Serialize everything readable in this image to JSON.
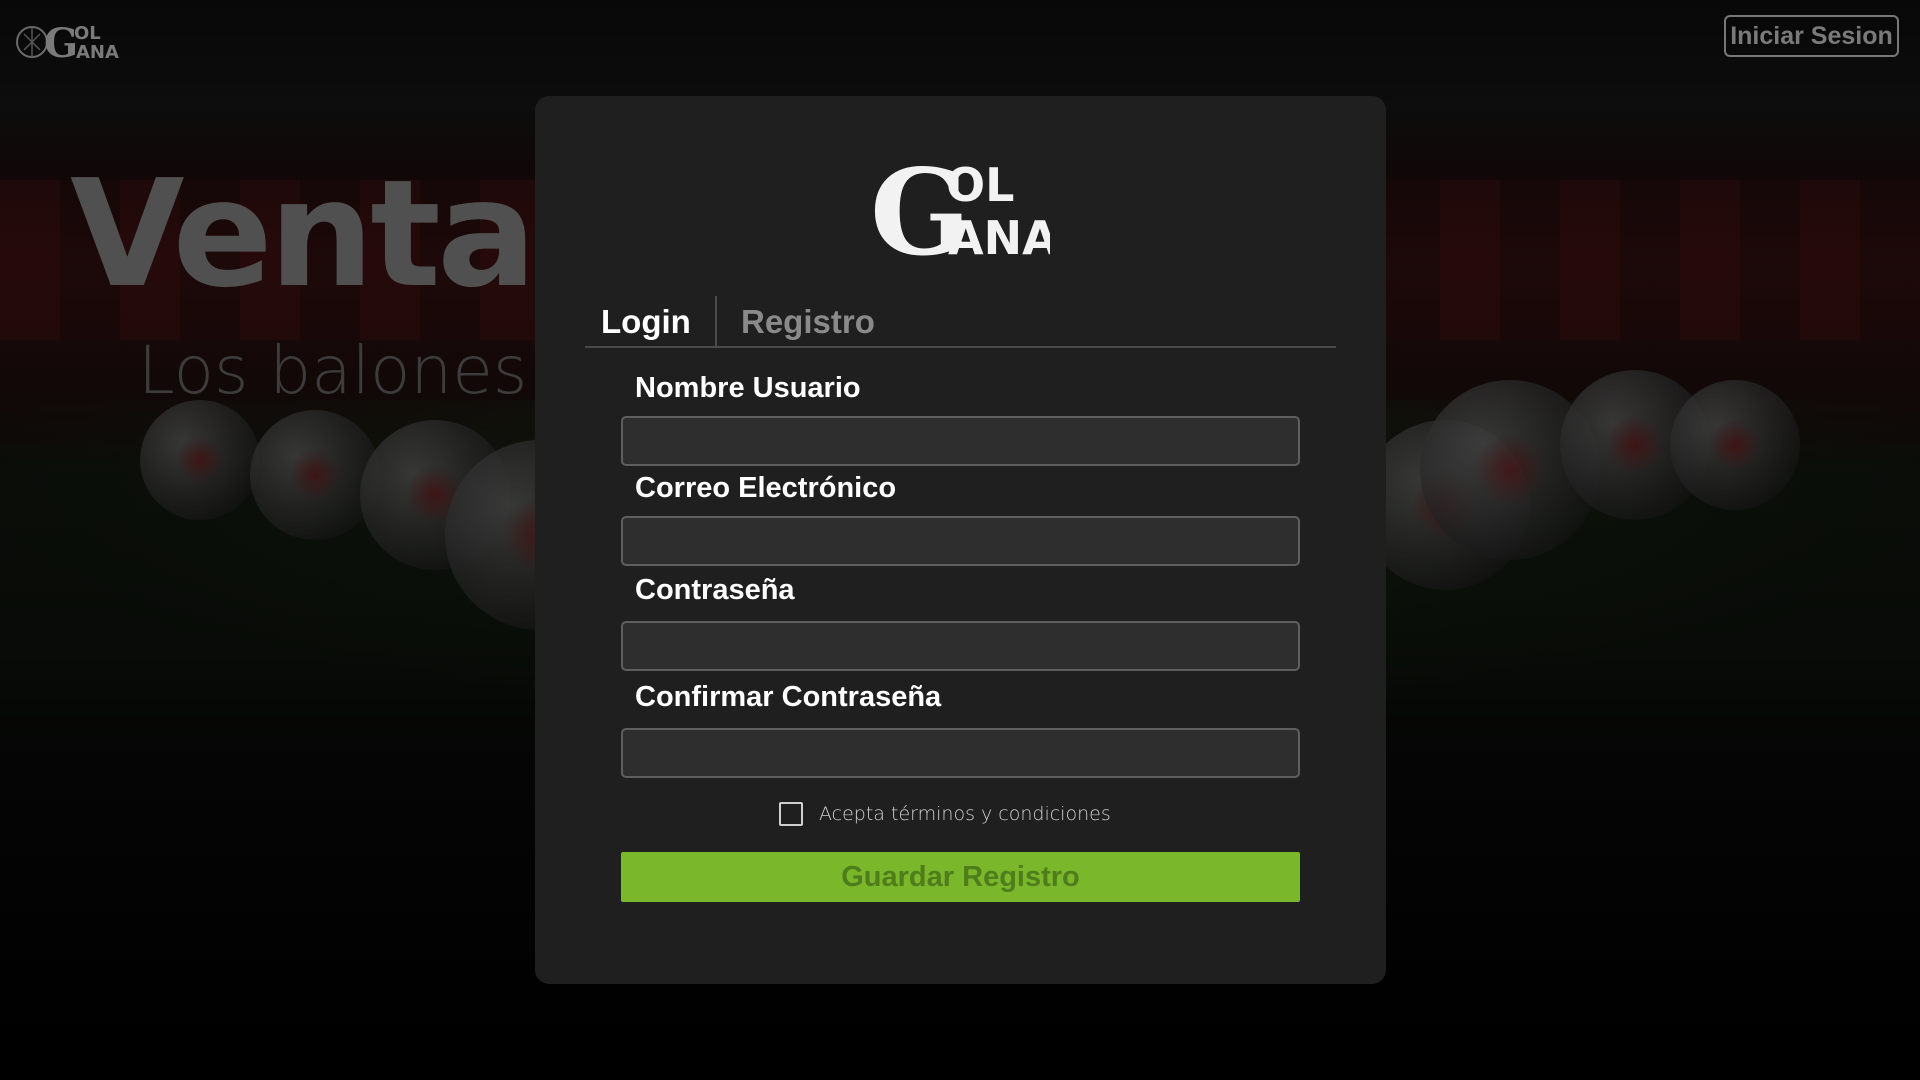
{
  "brand": {
    "logo_line1": "OL",
    "logo_line2": "ANA",
    "logo_initial": "G"
  },
  "header": {
    "login_button_label": "Iniciar Sesion"
  },
  "hero": {
    "title": "Venta",
    "subtitle": "Los balones"
  },
  "modal": {
    "tabs": [
      {
        "label": "Login",
        "active": true
      },
      {
        "label": "Registro",
        "active": false
      }
    ],
    "fields": [
      {
        "label": "Nombre Usuario",
        "value": ""
      },
      {
        "label": "Correo Electrónico",
        "value": ""
      },
      {
        "label": "Contraseña",
        "value": ""
      },
      {
        "label": "Confirmar Contraseña",
        "value": ""
      }
    ],
    "terms": {
      "label": "Acepta términos y condiciones",
      "checked": false
    },
    "submit_label": "Guardar Registro"
  },
  "colors": {
    "background": "#000000",
    "modal_bg": "#1f1f1f",
    "accent_green": "#7ab72b",
    "input_bg": "#2e2e2e",
    "input_border": "#5e5e5e"
  }
}
